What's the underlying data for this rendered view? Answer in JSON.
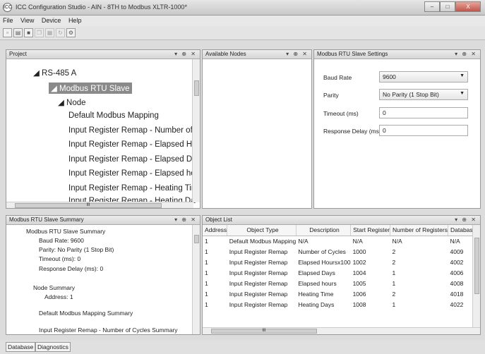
{
  "window": {
    "title": "ICC Configuration Studio - AIN - 8TH to Modbus XLTR-1000*",
    "app_icon": "ICC",
    "minimize": "–",
    "maximize": "□",
    "close": "X"
  },
  "menu": [
    "File",
    "View",
    "Device",
    "Help"
  ],
  "toolbar_icons": [
    "new-icon",
    "open-icon",
    "save-icon",
    "copy-icon",
    "paste-icon",
    "refresh-icon",
    "properties-icon"
  ],
  "project": {
    "header": "Project",
    "controls": "▾ ⊕ ✕",
    "tree": [
      {
        "label": "◢ RS-485 A"
      },
      {
        "label": "◢ Modbus RTU Slave"
      },
      {
        "label": "◢ Node"
      },
      {
        "label": "Default Modbus Mapping"
      },
      {
        "label": "Input Register Remap - Number of"
      },
      {
        "label": "Input Register Remap - Elapsed Ho"
      },
      {
        "label": "Input Register Remap - Elapsed Da"
      },
      {
        "label": "Input Register Remap - Elapsed ho"
      },
      {
        "label": "Input Register Remap - Heating Tin"
      },
      {
        "label": "Input Register Remap - Heating Da"
      }
    ],
    "scroll_thumb": "III"
  },
  "nodes": {
    "header": "Available Nodes",
    "controls": "▾ ⊕ ✕"
  },
  "settings": {
    "header": "Modbus RTU Slave Settings",
    "controls": "▾ ⊕ ✕",
    "baud_label": "Baud Rate",
    "baud_value": "9600",
    "parity_label": "Parity",
    "parity_value": "No Parity (1 Stop Bit)",
    "timeout_label": "Timeout (ms)",
    "timeout_value": "0",
    "delay_label": "Response Delay (ms)",
    "delay_value": "0"
  },
  "summary": {
    "header": "Modbus RTU Slave Summary",
    "controls": "▾ ⊕ ✕",
    "lines": [
      "Modbus RTU Slave Summary",
      "Baud Rate: 9600",
      "Parity: No Parity (1 Stop Bit)",
      "Timeout (ms): 0",
      "Response Delay (ms): 0",
      "Node Summary",
      "Address: 1",
      "Default Modbus Mapping Summary",
      "Input Register Remap - Number of Cycles Summary"
    ]
  },
  "objects": {
    "header": "Object List",
    "controls": "▾ ⊕ ✕",
    "columns": [
      "Address",
      "Object Type",
      "Description",
      "Start Register",
      "Number of Registers",
      "Database Ad"
    ],
    "rows": [
      [
        "1",
        "Default Modbus Mapping",
        "N/A",
        "N/A",
        "N/A",
        "N/A"
      ],
      [
        "1",
        "Input Register Remap",
        "Number of Cycles",
        "1000",
        "2",
        "4009"
      ],
      [
        "1",
        "Input Register Remap",
        "Elapsed Hoursx100",
        "1002",
        "2",
        "4002"
      ],
      [
        "1",
        "Input Register Remap",
        "Elapsed Days",
        "1004",
        "1",
        "4006"
      ],
      [
        "1",
        "Input Register Remap",
        "Elapsed hours",
        "1005",
        "1",
        "4008"
      ],
      [
        "1",
        "Input Register Remap",
        "Heating Time",
        "1006",
        "2",
        "4018"
      ],
      [
        "1",
        "Input Register Remap",
        "Heating Days",
        "1008",
        "1",
        "4022"
      ]
    ],
    "scroll_thumb": "III"
  },
  "status_tabs": [
    "Database",
    "Diagnostics"
  ]
}
